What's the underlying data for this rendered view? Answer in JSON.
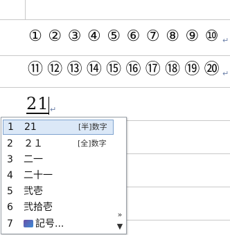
{
  "document": {
    "row1": [
      "①",
      "②",
      "③",
      "④",
      "⑤",
      "⑥",
      "⑦",
      "⑧",
      "⑨",
      "⑩"
    ],
    "row2": [
      "⑪",
      "⑫",
      "⑬",
      "⑭",
      "⑮",
      "⑯",
      "⑰",
      "⑱",
      "⑲",
      "⑳"
    ],
    "para_mark": "↵",
    "typed_text": "21"
  },
  "ime": {
    "candidates": [
      {
        "num": "1",
        "text": "21",
        "tag": "[半]数字"
      },
      {
        "num": "2",
        "text": "２１",
        "tag": "[全]数字"
      },
      {
        "num": "3",
        "text": "二一",
        "tag": ""
      },
      {
        "num": "4",
        "text": "二十一",
        "tag": ""
      },
      {
        "num": "5",
        "text": "弐壱",
        "tag": ""
      },
      {
        "num": "6",
        "text": "弐拾壱",
        "tag": ""
      },
      {
        "num": "7",
        "text": "記号...",
        "tag": ""
      }
    ],
    "expand_label": "»",
    "scroll_down_label": "▼"
  }
}
